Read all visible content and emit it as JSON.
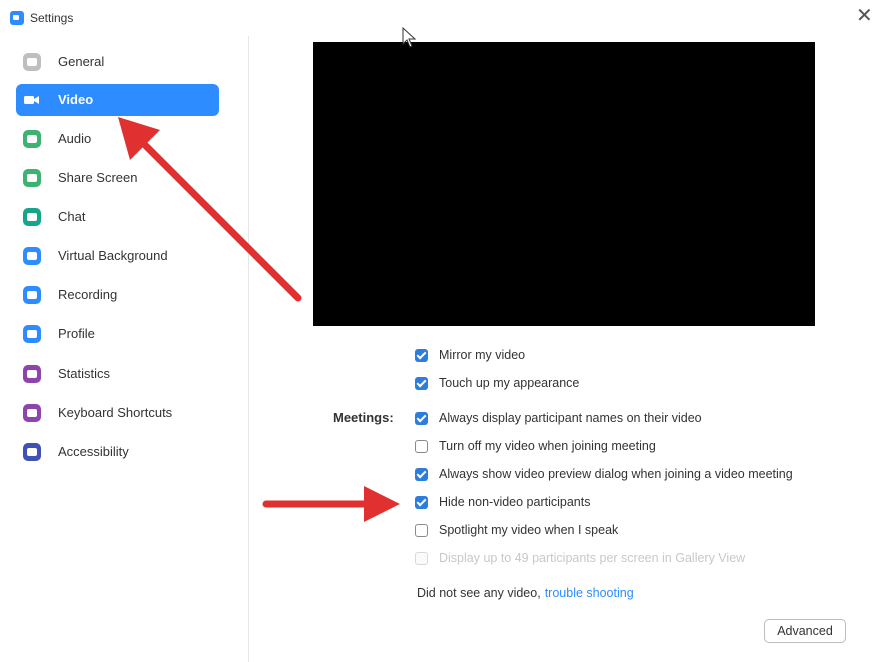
{
  "window": {
    "title": "Settings",
    "close_glyph": "✕"
  },
  "sidebar": {
    "items": [
      {
        "label": "General",
        "icon": "gear-icon",
        "color": "#bfbfbf",
        "active": false
      },
      {
        "label": "Video",
        "icon": "video-camera-icon",
        "color": "#2d8cff",
        "active": true
      },
      {
        "label": "Audio",
        "icon": "headphones-icon",
        "color": "#3cb371",
        "active": false
      },
      {
        "label": "Share Screen",
        "icon": "share-screen-icon",
        "color": "#3cb371",
        "active": false
      },
      {
        "label": "Chat",
        "icon": "chat-bubble-icon",
        "color": "#17a589",
        "active": false
      },
      {
        "label": "Virtual Background",
        "icon": "virtual-background-icon",
        "color": "#2d8cff",
        "active": false
      },
      {
        "label": "Recording",
        "icon": "record-icon",
        "color": "#2d8cff",
        "active": false
      },
      {
        "label": "Profile",
        "icon": "user-icon",
        "color": "#2d8cff",
        "active": false
      },
      {
        "label": "Statistics",
        "icon": "bar-chart-icon",
        "color": "#8e44ad",
        "active": false
      },
      {
        "label": "Keyboard Shortcuts",
        "icon": "keyboard-icon",
        "color": "#8e44ad",
        "active": false
      },
      {
        "label": "Accessibility",
        "icon": "accessibility-icon",
        "color": "#3f51b5",
        "active": false
      }
    ]
  },
  "video": {
    "meetings_label": "Meetings:",
    "options": [
      {
        "label": "Mirror my video",
        "checked": true
      },
      {
        "label": "Touch up my appearance",
        "checked": true
      },
      {
        "label": "Always display participant names on their video",
        "checked": true
      },
      {
        "label": "Turn off my video when joining meeting",
        "checked": false
      },
      {
        "label": "Always show video preview dialog when joining a video meeting",
        "checked": true
      },
      {
        "label": "Hide non-video participants",
        "checked": true
      },
      {
        "label": "Spotlight my video when I speak",
        "checked": false
      },
      {
        "label": "Display up to 49 participants per screen in Gallery View",
        "checked": false,
        "disabled": true
      }
    ],
    "help_text": "Did not see any video,",
    "help_link": "trouble shooting",
    "advanced_label": "Advanced"
  },
  "colors": {
    "accent": "#2d8cff",
    "annotation_arrow": "#e0302f"
  }
}
